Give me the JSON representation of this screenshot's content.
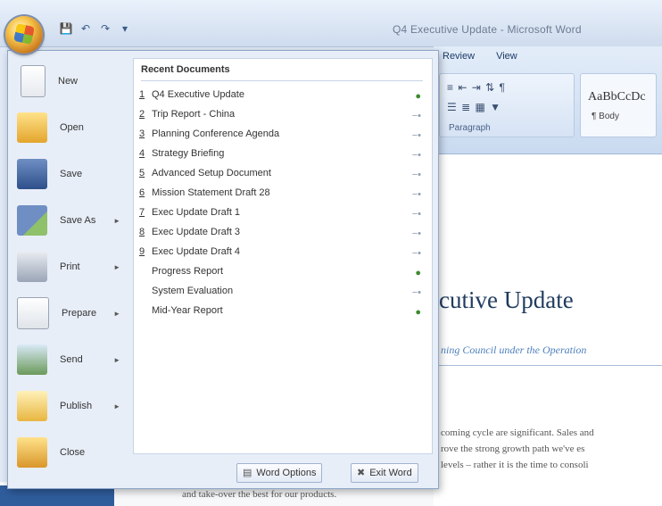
{
  "window": {
    "title": "Q4 Executive Update - Microsoft Word",
    "quick_access": [
      "save-icon",
      "undo-icon",
      "redo-icon",
      "customize-icon"
    ]
  },
  "ribbon": {
    "tabs": [
      "Review",
      "View"
    ],
    "group_label": "Paragraph",
    "style_sample": "AaBbCcDc",
    "style_name": "¶ Body"
  },
  "office_menu": {
    "left_items": [
      {
        "label": "New",
        "icon": "new-document-icon",
        "has_arrow": false
      },
      {
        "label": "Open",
        "icon": "open-folder-icon",
        "has_arrow": false
      },
      {
        "label": "Save",
        "icon": "save-icon",
        "has_arrow": false
      },
      {
        "label": "Save As",
        "icon": "save-as-icon",
        "has_arrow": true
      },
      {
        "label": "Print",
        "icon": "print-icon",
        "has_arrow": true
      },
      {
        "label": "Prepare",
        "icon": "prepare-icon",
        "has_arrow": true
      },
      {
        "label": "Send",
        "icon": "send-icon",
        "has_arrow": true
      },
      {
        "label": "Publish",
        "icon": "publish-icon",
        "has_arrow": true
      },
      {
        "label": "Close",
        "icon": "close-folder-icon",
        "has_arrow": false
      }
    ],
    "recent_header": "Recent Documents",
    "recent_documents": [
      {
        "num": "1",
        "name": "Q4 Executive Update",
        "pinned": true
      },
      {
        "num": "2",
        "name": "Trip Report - China",
        "pinned": false
      },
      {
        "num": "3",
        "name": "Planning Conference Agenda",
        "pinned": false
      },
      {
        "num": "4",
        "name": "Strategy Briefing",
        "pinned": false
      },
      {
        "num": "5",
        "name": "Advanced Setup Document",
        "pinned": false
      },
      {
        "num": "6",
        "name": "Mission Statement Draft 28",
        "pinned": false
      },
      {
        "num": "7",
        "name": "Exec Update Draft 1",
        "pinned": false
      },
      {
        "num": "8",
        "name": "Exec Update Draft 3",
        "pinned": false
      },
      {
        "num": "9",
        "name": "Exec Update Draft 4",
        "pinned": false
      },
      {
        "num": "",
        "name": "Progress Report",
        "pinned": true
      },
      {
        "num": "",
        "name": "System Evaluation",
        "pinned": false
      },
      {
        "num": "",
        "name": "Mid-Year Report",
        "pinned": true
      }
    ],
    "word_options_label": "Word Options",
    "exit_label": "Exit Word"
  },
  "document": {
    "heading": "cutive Update",
    "subtitle": "ning Council under the Operation",
    "lines": [
      "coming cycle are significant. Sales and",
      "rove the strong growth path we've es",
      "levels – rather it is the time to consoli"
    ],
    "bottom_line": "and take-over the best for our products."
  },
  "colors": {
    "accent": "#2f5d9c",
    "heading": "#1f3b5e",
    "subtitle": "#4f81bd"
  }
}
